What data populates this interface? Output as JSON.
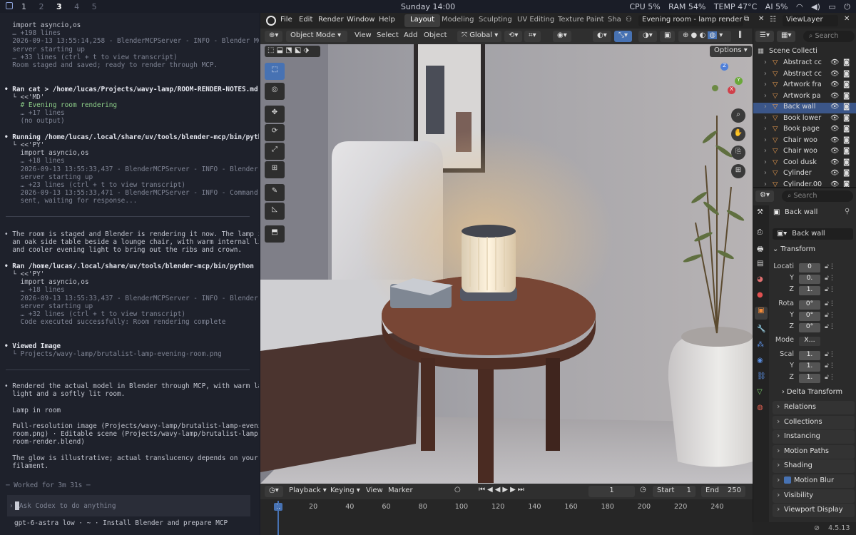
{
  "topbar": {
    "workspaces": [
      "1",
      "2",
      "3",
      "4",
      "5"
    ],
    "clock": "Sunday 14:00",
    "stats": {
      "cpu": "CPU 5%",
      "ram": "RAM 54%",
      "temp": "TEMP 47°C",
      "ai": "AI 5%"
    }
  },
  "terminal": {
    "lines": [
      {
        "t": "  import asyncio,os",
        "c": "n"
      },
      {
        "t": "  … +198 lines",
        "c": "dim"
      },
      {
        "t": "  2026-09-13 13:55:14,258 - BlenderMCPServer - INFO - Blender MCP",
        "c": "dim"
      },
      {
        "t": "  server starting up",
        "c": "dim"
      },
      {
        "t": "  … +33 lines (ctrl + t to view transcript)",
        "c": "dim"
      },
      {
        "t": "  Room staged and saved; ready to render through MCP.",
        "c": "dim"
      },
      {
        "t": "",
        "c": "n"
      },
      {
        "t": "",
        "c": "n"
      },
      {
        "t": "• Ran cat > /home/lucas/Projects/wavy-lamp/ROOM-RENDER-NOTES.md",
        "c": "bold"
      },
      {
        "t": "  └ <<'MD'",
        "c": "n"
      },
      {
        "t": "    # Evening room rendering",
        "c": "ok"
      },
      {
        "t": "    … +17 lines",
        "c": "dim"
      },
      {
        "t": "    (no output)",
        "c": "dim"
      },
      {
        "t": "",
        "c": "n"
      },
      {
        "t": "• Running /home/lucas/.local/share/uv/tools/blender-mcp/bin/python -",
        "c": "bold"
      },
      {
        "t": "  └ <<'PY'",
        "c": "n"
      },
      {
        "t": "    import asyncio,os",
        "c": "n"
      },
      {
        "t": "    … +18 lines",
        "c": "dim"
      },
      {
        "t": "    2026-09-13 13:55:33,437 - BlenderMCPServer - INFO - Blender MCP",
        "c": "dim"
      },
      {
        "t": "    server starting up",
        "c": "dim"
      },
      {
        "t": "    … +23 lines (ctrl + t to view transcript)",
        "c": "dim"
      },
      {
        "t": "    2026-09-13 13:55:33,471 - BlenderMCPServer - INFO - Command",
        "c": "dim"
      },
      {
        "t": "    sent, waiting for response...",
        "c": "dim"
      }
    ],
    "lines2": [
      {
        "t": "• The room is staged and Blender is rendering it now. The lamp is on",
        "c": "n"
      },
      {
        "t": "  an oak side table beside a lounge chair, with warm internal light",
        "c": "n"
      },
      {
        "t": "  and cooler evening light to bring out the ribs and crown.",
        "c": "n"
      },
      {
        "t": "",
        "c": "n"
      },
      {
        "t": "• Ran /home/lucas/.local/share/uv/tools/blender-mcp/bin/python -",
        "c": "bold"
      },
      {
        "t": "  └ <<'PY'",
        "c": "n"
      },
      {
        "t": "    import asyncio,os",
        "c": "n"
      },
      {
        "t": "    … +18 lines",
        "c": "dim"
      },
      {
        "t": "    2026-09-13 13:55:33,437 - BlenderMCPServer - INFO - Blender MCP",
        "c": "dim"
      },
      {
        "t": "    server starting up",
        "c": "dim"
      },
      {
        "t": "    … +32 lines (ctrl + t to view transcript)",
        "c": "dim"
      },
      {
        "t": "    Code executed successfully: Room rendering complete",
        "c": "dim"
      },
      {
        "t": "",
        "c": "n"
      },
      {
        "t": "",
        "c": "n"
      },
      {
        "t": "• Viewed Image",
        "c": "bold"
      },
      {
        "t": "  └ Projects/wavy-lamp/brutalist-lamp-evening-room.png",
        "c": "dim"
      }
    ],
    "lines3": [
      {
        "t": "• Rendered the actual model in Blender through MCP, with warm lamp",
        "c": "n"
      },
      {
        "t": "  light and a softly lit room.",
        "c": "n"
      },
      {
        "t": "",
        "c": "n"
      },
      {
        "t": "  Lamp in room",
        "c": "n"
      },
      {
        "t": "",
        "c": "n"
      },
      {
        "t": "  Full-resolution image (Projects/wavy-lamp/brutalist-lamp-evening-",
        "c": "n"
      },
      {
        "t": "  room.png) · Editable scene (Projects/wavy-lamp/brutalist-lamp-",
        "c": "n"
      },
      {
        "t": "  room-render.blend)",
        "c": "n"
      },
      {
        "t": "",
        "c": "n"
      },
      {
        "t": "  The glow is illustrative; actual translucency depends on your",
        "c": "n"
      },
      {
        "t": "  filament.",
        "c": "n"
      }
    ],
    "worked": "─ Worked for 3m 31s ─",
    "prompt_placeholder": "Ask Codex to do anything",
    "footer": "gpt-6-astra low · ~ · Install Blender and prepare MCP"
  },
  "blender": {
    "menu": [
      "File",
      "Edit",
      "Render",
      "Window",
      "Help"
    ],
    "tabs": [
      "Layout",
      "Modeling",
      "Sculpting",
      "UV Editing",
      "Texture Paint",
      "Sha"
    ],
    "active_tab": "Layout",
    "scene_name": "Evening room - lamp render",
    "view_layer": "ViewLayer",
    "viewport_header": {
      "mode": "Object Mode",
      "menu": [
        "View",
        "Select",
        "Add",
        "Object"
      ],
      "transform": "Global",
      "options": "Options"
    },
    "outliner": {
      "search_placeholder": "Search",
      "root": "Scene Collecti",
      "items": [
        "Abstract cc",
        "Abstract cc",
        "Artwork fra",
        "Artwork pa",
        "Back wall",
        "Book lower",
        "Book page",
        "Chair woo",
        "Chair woo",
        "Cool dusk",
        "Cylinder",
        "Cylinder.00"
      ],
      "selected_index": 4
    },
    "properties": {
      "search_placeholder": "Search",
      "object_name": "Back wall",
      "data_name": "Back wall",
      "transform_title": "Transform",
      "location_label": "Locati",
      "location": [
        "0",
        "0.",
        "1."
      ],
      "rotation_label": "Rota",
      "rotation": [
        "0°",
        "0°",
        "0°"
      ],
      "mode_label": "Mode",
      "mode_value": "X…",
      "scale_label": "Scal",
      "scale": [
        "1.",
        "1.",
        "1."
      ],
      "axis": [
        "Y",
        "Z"
      ],
      "delta": "Delta Transform",
      "panels": [
        "Relations",
        "Collections",
        "Instancing",
        "Motion Paths",
        "Shading",
        "Motion Blur",
        "Visibility",
        "Viewport Display"
      ]
    },
    "timeline": {
      "menu": [
        "Playback",
        "Keying",
        "View",
        "Marker"
      ],
      "current_frame": "1",
      "start_label": "Start",
      "start": "1",
      "end_label": "End",
      "end": "250",
      "ticks": [
        "1",
        "20",
        "40",
        "60",
        "80",
        "100",
        "120",
        "140",
        "160",
        "180",
        "200",
        "220",
        "240"
      ]
    },
    "version": "4.5.13"
  }
}
